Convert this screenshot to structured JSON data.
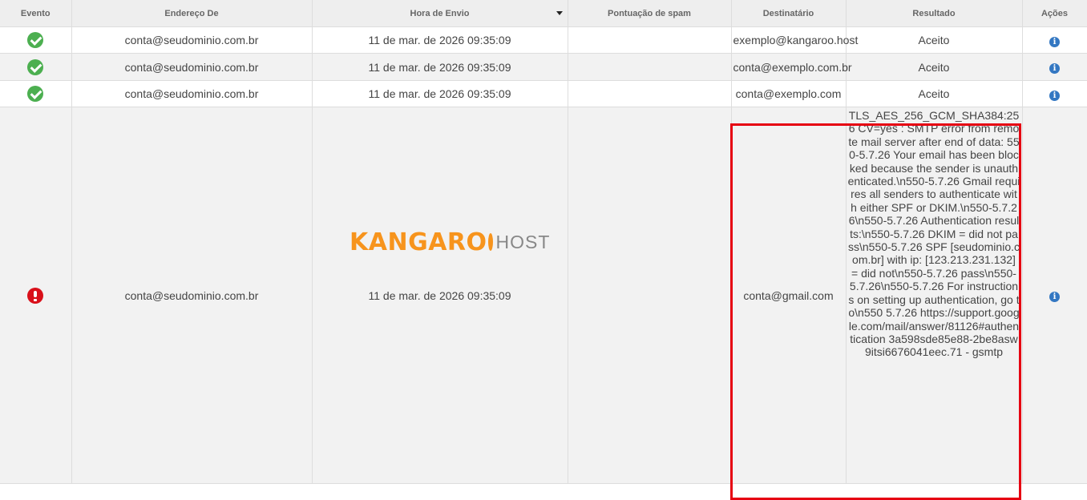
{
  "columns": {
    "evento": "Evento",
    "endereco_de": "Endereço De",
    "hora_envio": "Hora de Envio",
    "pontuacao_spam": "Pontuação de spam",
    "destinatario": "Destinatário",
    "resultado": "Resultado",
    "acoes": "Ações"
  },
  "sort": {
    "column": "hora_envio",
    "direction": "descending"
  },
  "rows": [
    {
      "status_icon": "check-circle-icon",
      "from": "conta@seudominio.com.br",
      "sent": "11 de mar. de 2026 09:35:09",
      "spam_score": "",
      "to": "exemplo@kangaroo.host",
      "result": "Aceito"
    },
    {
      "status_icon": "check-circle-icon",
      "from": "conta@seudominio.com.br",
      "sent": "11 de mar. de 2026 09:35:09",
      "spam_score": "",
      "to": "conta@exemplo.com.br",
      "result": "Aceito"
    },
    {
      "status_icon": "check-circle-icon",
      "from": "conta@seudominio.com.br",
      "sent": "11 de mar. de 2026 09:35:09",
      "spam_score": "",
      "to": "conta@exemplo.com",
      "result": "Aceito"
    },
    {
      "status_icon": "error-circle-icon",
      "from": "conta@seudominio.com.br",
      "sent": "11 de mar. de 2026 09:35:09",
      "spam_score": "",
      "to": "conta@gmail.com",
      "result": "TLS_AES_256_GCM_SHA384:256 CV=yes : SMTP error from remote mail server after end of data: 550-5.7.26 Your email has been blocked because the sender is unauthenticated.\\n550-5.7.26 Gmail requires all senders to authenticate with either SPF or DKIM.\\n550-5.7.26\\n550-5.7.26 Authentication results:\\n550-5.7.26 DKIM = did not pass\\n550-5.7.26 SPF [seudominio.com.br] with ip: [123.213.231.132] = did not\\n550-5.7.26 pass\\n550-5.7.26\\n550-5.7.26 For instructions on setting up authentication, go to\\n550 5.7.26 https://support.google.com/mail/answer/81126#authentication 3a598sde85e88-2be8asw9itsi6676041eec.71 - gsmtp"
    }
  ],
  "action_icon": "info-icon",
  "action_glyph": "i",
  "colors": {
    "success": "#4caf50",
    "error": "#d9101a",
    "info": "#3377c2",
    "highlight_border": "#e60012",
    "logo_orange": "#f7941d",
    "header_bg": "#eeeeee",
    "row_shade": "#f2f2f2"
  },
  "brand": {
    "big": "KANGARO",
    "small": "HOST"
  }
}
